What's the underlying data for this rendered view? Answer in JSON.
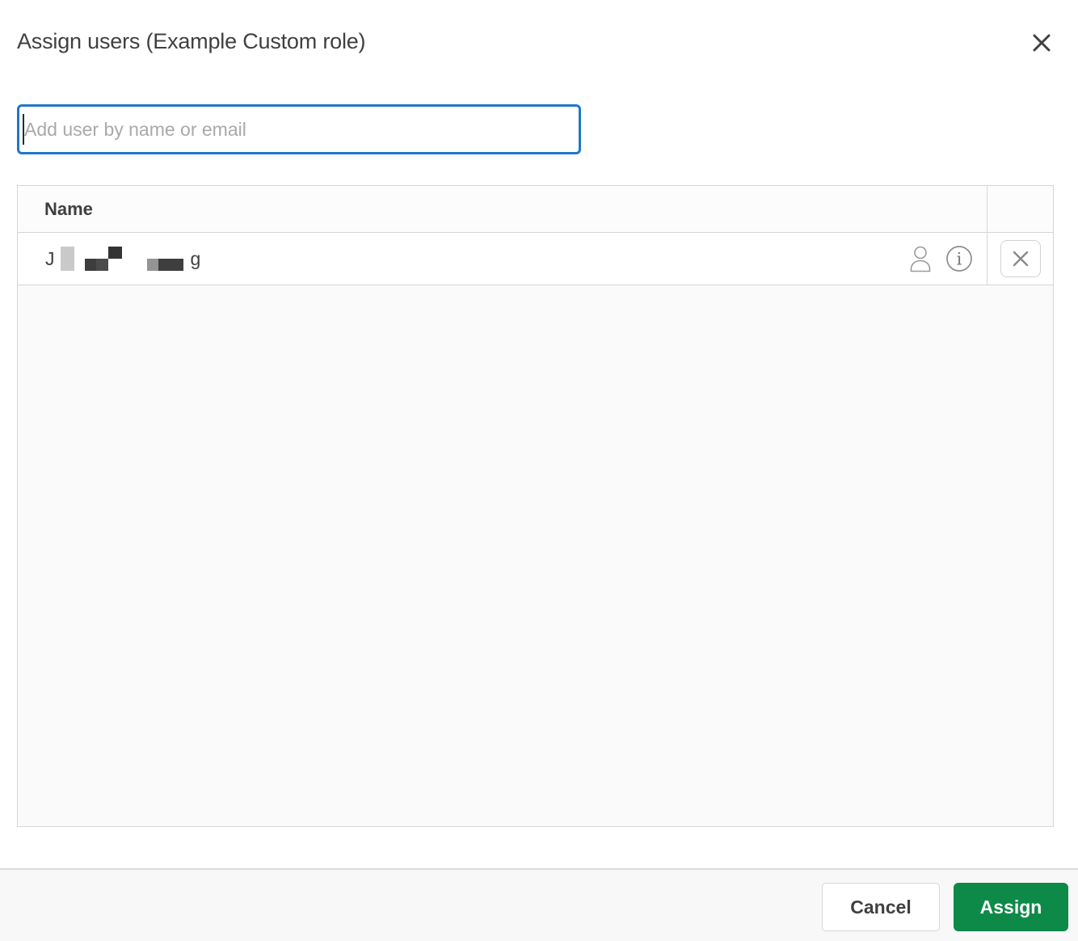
{
  "dialog": {
    "title": "Assign users (Example Custom role)"
  },
  "search": {
    "placeholder": "Add user by name or email",
    "value": ""
  },
  "table": {
    "columns": [
      {
        "label": "Name"
      },
      {
        "label": ""
      }
    ],
    "rows": [
      {
        "name_first_fragment": "J",
        "name_last_fragment": "g",
        "name_redacted": true,
        "icons": [
          "user-icon",
          "info-icon"
        ],
        "remove_icon": "x-icon"
      }
    ]
  },
  "footer": {
    "cancel_label": "Cancel",
    "assign_label": "Assign"
  },
  "colors": {
    "focus_blue": "#2077c8",
    "assign_green": "#0e8a48",
    "border_gray": "#d6d6d6",
    "text_dark": "#404040",
    "icon_gray": "#8d8d8d"
  }
}
